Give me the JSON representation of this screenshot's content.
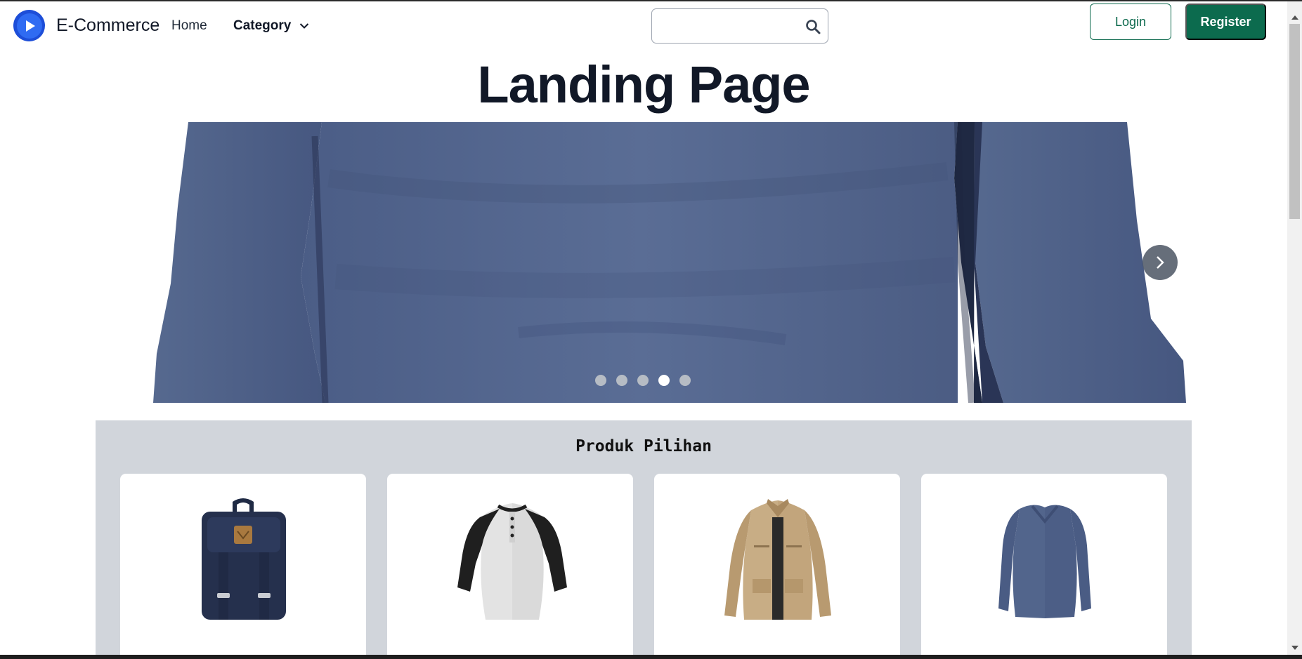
{
  "brand": {
    "name": "E-Commerce",
    "logo_icon": "play-logo-icon"
  },
  "nav": {
    "home": "Home",
    "category": "Category"
  },
  "search": {
    "value": "",
    "placeholder": ""
  },
  "auth": {
    "login": "Login",
    "register": "Register"
  },
  "hero": {
    "title": "Landing Page",
    "slide_count": 5,
    "active_slide": 4
  },
  "featured": {
    "title": "Produk Pilihan",
    "products": [
      "backpack",
      "raglan-henley-shirt",
      "khaki-jacket",
      "blue-long-sleeve-shirt"
    ]
  },
  "colors": {
    "accent": "#0c6b4e",
    "brand": "#1d4ed8",
    "section_bg": "#d1d5db"
  }
}
